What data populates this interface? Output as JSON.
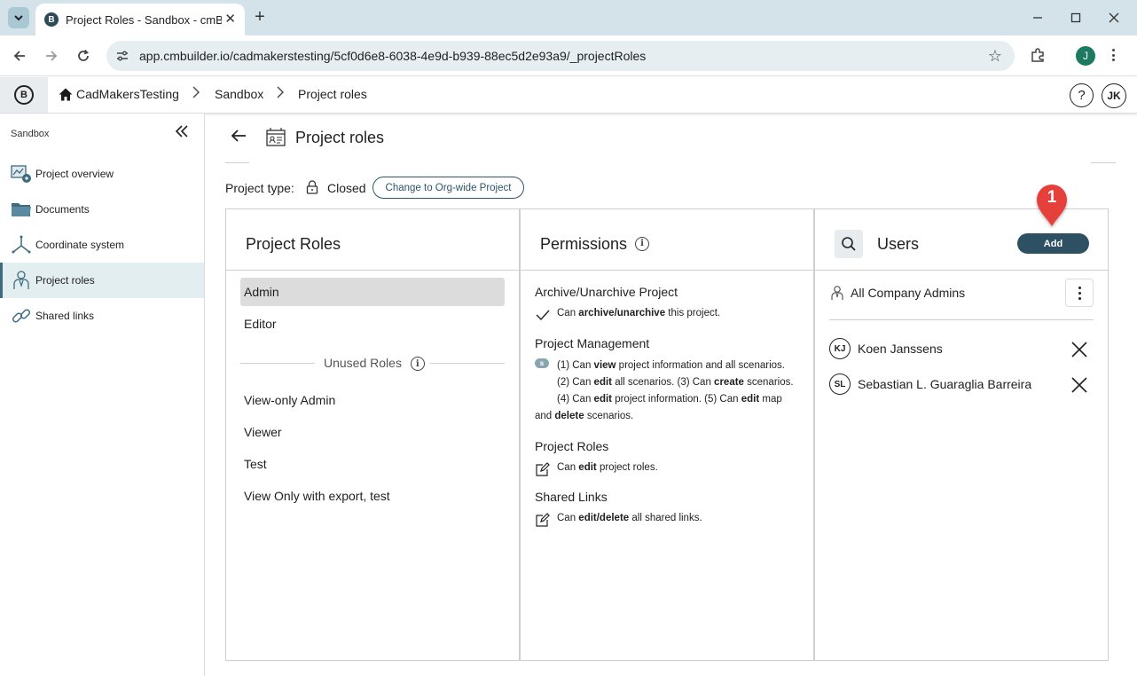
{
  "browser": {
    "tab_title": "Project Roles - Sandbox - cmBuilder",
    "tab_favicon": "B",
    "url": "app.cmbuilder.io/cadmakerstesting/5cf0d6e8-6038-4e9d-b939-88ec5d2e93a9/_projectRoles",
    "profile_initial": "J"
  },
  "header": {
    "logo_letter": "B",
    "breadcrumbs": [
      "CadMakersTesting",
      "Sandbox",
      "Project roles"
    ],
    "help": "?",
    "user_initials": "JK"
  },
  "sidebar": {
    "title": "Sandbox",
    "items": [
      {
        "label": "Project overview",
        "icon": "project-overview-icon"
      },
      {
        "label": "Documents",
        "icon": "folder-icon"
      },
      {
        "label": "Coordinate system",
        "icon": "coordinate-axes-icon"
      },
      {
        "label": "Project roles",
        "icon": "person-role-icon",
        "active": true
      },
      {
        "label": "Shared links",
        "icon": "link-icon"
      }
    ]
  },
  "main": {
    "title": "Project roles",
    "project_type_label": "Project type:",
    "project_type_value": "Closed",
    "change_button": "Change to Org-wide Project"
  },
  "roles_panel": {
    "title": "Project Roles",
    "used_roles": [
      "Admin",
      "Editor"
    ],
    "unused_label": "Unused Roles",
    "unused_roles": [
      "View-only Admin",
      "Viewer",
      "Test",
      "View Only with export, test"
    ]
  },
  "permissions_panel": {
    "title": "Permissions",
    "groups": {
      "archive": {
        "title": "Archive/Unarchive Project",
        "pre": "Can ",
        "bold": "archive/unarchive",
        "post": " this project."
      },
      "management": {
        "title": "Project Management",
        "badge": "s",
        "parts": [
          "(1) Can ",
          "view",
          " project information and all scenarios.",
          "(2) Can ",
          "edit",
          " all scenarios. (3) Can ",
          "create",
          " scenarios.",
          "(4) Can ",
          "edit",
          " project information. (5) Can ",
          "edit",
          " map",
          "and ",
          "delete",
          " scenarios."
        ]
      },
      "roles": {
        "title": "Project Roles",
        "pre": "Can ",
        "bold": "edit",
        "post": " project roles."
      },
      "links": {
        "title": "Shared Links",
        "pre": "Can ",
        "bold": "edit/delete",
        "post": " all shared links."
      }
    }
  },
  "users_panel": {
    "title": "Users",
    "add_button": "Add",
    "step_marker": "1",
    "all_admins_label": "All Company Admins",
    "users": [
      {
        "initials": "KJ",
        "name": "Koen Janssens"
      },
      {
        "initials": "SL",
        "name": "Sebastian L. Guaraglia Barreira"
      }
    ]
  },
  "colors": {
    "accent": "#2d5163",
    "marker": "#e5403a",
    "active_bg": "#e3eef1",
    "selected_role_bg": "#dcdcdc",
    "chrome_bg": "#d3e3e9"
  }
}
